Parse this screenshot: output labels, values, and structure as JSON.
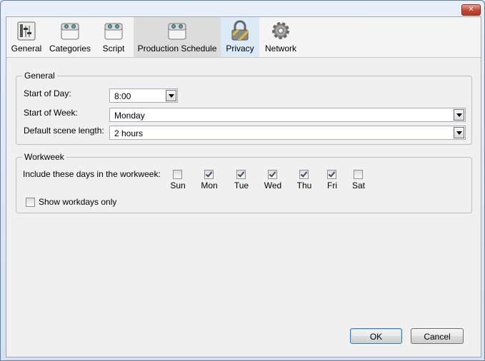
{
  "window": {
    "close_glyph": "✕"
  },
  "toolbar": {
    "items": [
      {
        "label": "General",
        "icon": "general-prefs-icon"
      },
      {
        "label": "Categories",
        "icon": "categories-icon"
      },
      {
        "label": "Script",
        "icon": "script-icon"
      },
      {
        "label": "Production Schedule",
        "icon": "production-schedule-icon",
        "state": "selected"
      },
      {
        "label": "Privacy",
        "icon": "padlock-icon",
        "state": "hover"
      },
      {
        "label": "Network",
        "icon": "gear-icon"
      }
    ]
  },
  "general_group": {
    "title": "General",
    "start_of_day_label": "Start of Day:",
    "start_of_day_value": "8:00",
    "start_of_week_label": "Start of Week:",
    "start_of_week_value": "Monday",
    "scene_length_label": "Default scene length:",
    "scene_length_value": "2 hours"
  },
  "workweek_group": {
    "title": "Workweek",
    "include_label": "Include these days in the workweek:",
    "days": [
      {
        "label": "Sun",
        "checked": false
      },
      {
        "label": "Mon",
        "checked": true
      },
      {
        "label": "Tue",
        "checked": true
      },
      {
        "label": "Wed",
        "checked": true
      },
      {
        "label": "Thu",
        "checked": true
      },
      {
        "label": "Fri",
        "checked": true
      },
      {
        "label": "Sat",
        "checked": false
      }
    ],
    "show_workdays_label": "Show workdays only",
    "show_workdays_checked": false
  },
  "buttons": {
    "ok": "OK",
    "cancel": "Cancel"
  },
  "colors": {
    "window_frame": "#dbe6f3",
    "dialog_bg": "#f0f0f0",
    "selected_tab": "#dcdcdc",
    "hover_tab": "#dce9f7"
  }
}
